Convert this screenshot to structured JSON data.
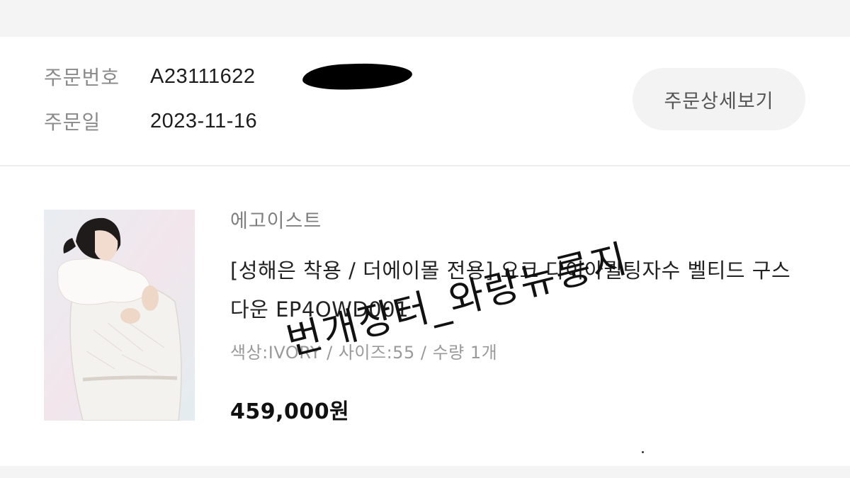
{
  "order": {
    "number_label": "주문번호",
    "number_value": "A23111622",
    "date_label": "주문일",
    "date_value": "2023-11-16",
    "detail_button": "주문상세보기"
  },
  "product": {
    "brand": "에고이스트",
    "title": "[성해은 착용 / 더에이몰 전용] 요크 다이아퀼팅자수 벨티드 구스 다운 EP4OWD001",
    "option": "색상:IVORY / 사이즈:55 / 수량 1개",
    "price": "459,000원",
    "image_icon": "product-photo"
  },
  "watermark": "번개장터_와랑뉴룽지",
  "colors": {
    "background": "#f4f4f5",
    "card": "#ffffff",
    "muted_text": "#8a8a8a",
    "button_bg": "#f3f3f4"
  }
}
